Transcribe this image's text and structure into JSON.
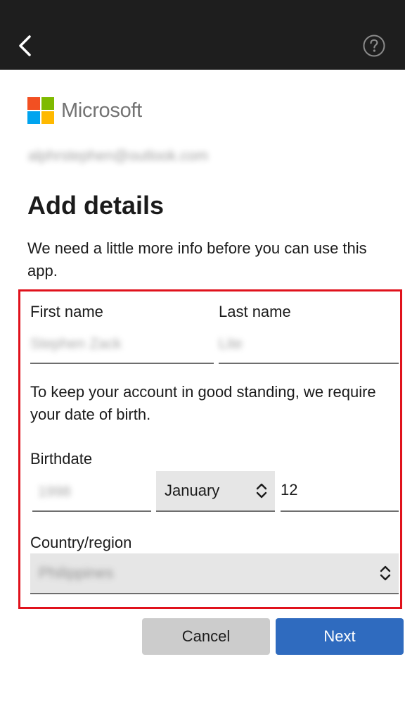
{
  "brand": {
    "name": "Microsoft",
    "colors": {
      "red": "#f25022",
      "green": "#7fba00",
      "blue": "#00a4ef",
      "yellow": "#ffb900"
    }
  },
  "account": {
    "email": "alphrstephen@outlook.com"
  },
  "page": {
    "title": "Add details",
    "description": "We need a little more info before you can use this app."
  },
  "form": {
    "first_name": {
      "label": "First name",
      "value": "Stephen Zack"
    },
    "last_name": {
      "label": "Last name",
      "value": "Lite"
    },
    "dob_note": "To keep your account in good standing, we require your date of birth.",
    "birthdate": {
      "label": "Birthdate",
      "year": "1998",
      "month": "January",
      "day": "12"
    },
    "country": {
      "label": "Country/region",
      "value": "Philippines"
    }
  },
  "buttons": {
    "cancel": "Cancel",
    "next": "Next"
  },
  "icons": {
    "back": "chevron-left-icon",
    "help": "question-circle-icon",
    "select": "chevron-updown-icon"
  },
  "accent": {
    "highlight": "#e0121c",
    "primary": "#2f6bbf"
  }
}
